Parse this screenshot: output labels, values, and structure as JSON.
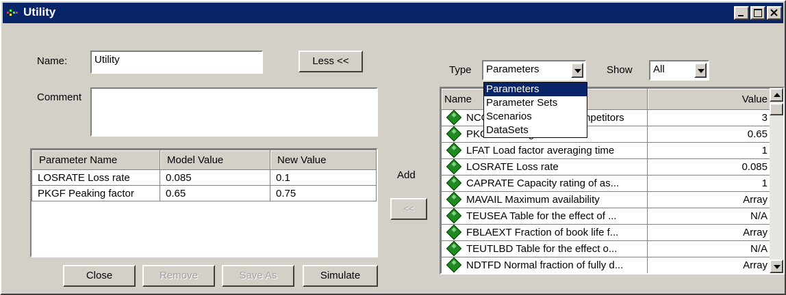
{
  "window": {
    "title": "Utility"
  },
  "form": {
    "name_label": "Name:",
    "name_value": "Utility",
    "comment_label": "Comment",
    "comment_value": "",
    "less_button": "Less <<"
  },
  "left_table": {
    "columns": [
      "Parameter Name",
      "Model Value",
      "New Value"
    ],
    "rows": [
      [
        "LOSRATE Loss rate",
        "0.085",
        "0.1"
      ],
      [
        "PKGF Peaking factor",
        "0.65",
        "0.75"
      ]
    ]
  },
  "buttons": {
    "close": "Close",
    "remove": "Remove",
    "save_as": "Save As",
    "simulate": "Simulate"
  },
  "add": {
    "label": "Add",
    "button": "<<"
  },
  "filters": {
    "type_label": "Type",
    "type_value": "Parameters",
    "show_label": "Show",
    "show_value": "All",
    "type_options": [
      "Parameters",
      "Parameter Sets",
      "Scenarios",
      "DataSets"
    ]
  },
  "right_table": {
    "columns": [
      "Name",
      "Value"
    ],
    "rows": [
      [
        "NCOMPET Number of competitors",
        "3"
      ],
      [
        "PKGF Peaking factor",
        "0.65"
      ],
      [
        "LFAT Load factor averaging time",
        "1"
      ],
      [
        "LOSRATE Loss rate",
        "0.085"
      ],
      [
        "CAPRATE Capacity rating of as...",
        "1"
      ],
      [
        "MAVAIL Maximum availability",
        "Array"
      ],
      [
        "TEUSEA Table for the effect of ...",
        "N/A"
      ],
      [
        "FBLAEXT Fraction of book life f...",
        "Array"
      ],
      [
        "TEUTLBD Table for the effect o...",
        "N/A"
      ],
      [
        "NDTFD Normal fraction of fully d...",
        "Array"
      ]
    ]
  }
}
